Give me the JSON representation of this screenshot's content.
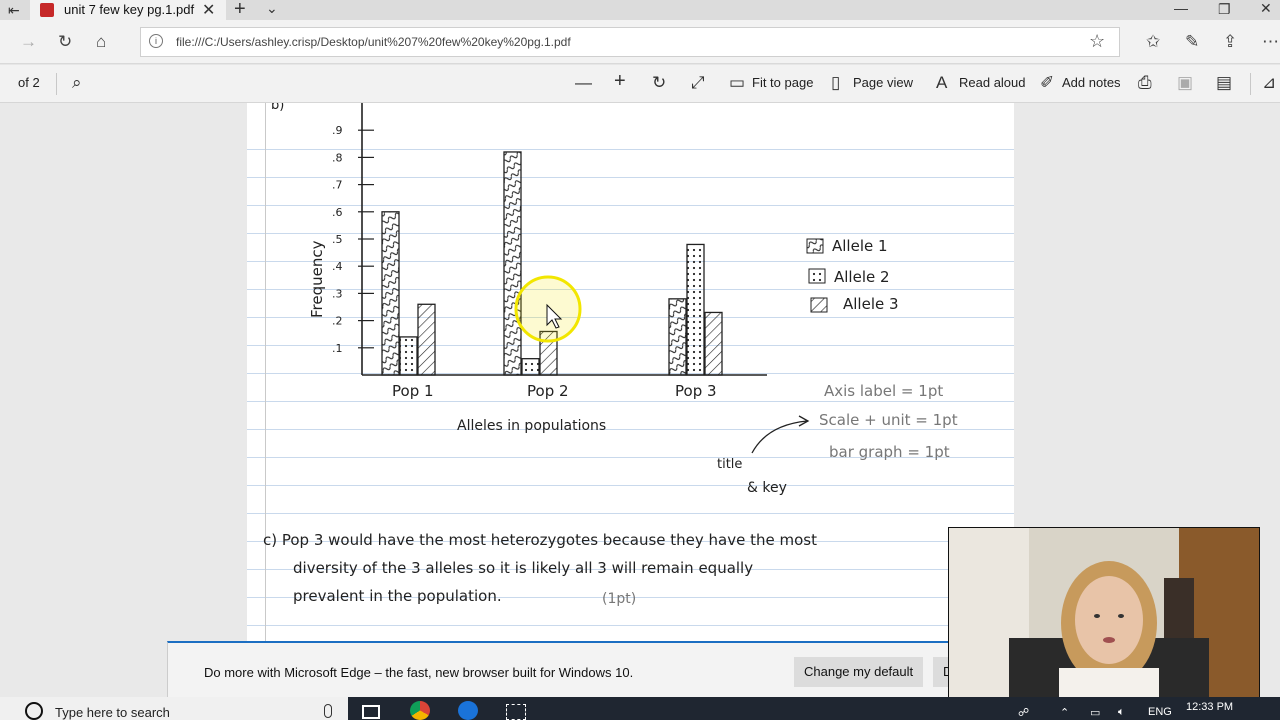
{
  "browser": {
    "tab_title": "unit 7 few key pg.1.pdf",
    "url": "file:///C:/Users/ashley.crisp/Desktop/unit%207%20few%20key%20pg.1.pdf"
  },
  "pdf_toolbar": {
    "page_count": "of 2",
    "fit_to_page": "Fit to page",
    "page_view": "Page view",
    "read_aloud": "Read aloud",
    "add_notes": "Add notes"
  },
  "document": {
    "question_label": "b)",
    "y_axis_label": "Frequency",
    "y_ticks": [
      ".1",
      ".2",
      ".3",
      ".4",
      ".5",
      ".6",
      ".7",
      ".8",
      ".9"
    ],
    "x_categories": [
      "Pop 1",
      "Pop 2",
      "Pop 3"
    ],
    "x_axis_label": "Alleles in populations",
    "legend": [
      "Allele 1",
      "Allele 2",
      "Allele 3"
    ],
    "rubric": [
      "Axis label = 1pt",
      "Scale + unit = 1pt",
      "bar graph = 1pt"
    ],
    "annotation_title": "title",
    "annotation_key": "& key",
    "answer_c": [
      "c) Pop 3 would have the most heterozygotes because they have the most",
      "diversity of the 3 alleles so it is likely all 3 will remain equally",
      "prevalent in the population."
    ],
    "answer_points": "(1pt)"
  },
  "chart_data": {
    "type": "bar",
    "categories": [
      "Pop 1",
      "Pop 2",
      "Pop 3"
    ],
    "series": [
      {
        "name": "Allele 1",
        "values": [
          0.6,
          0.82,
          0.28
        ]
      },
      {
        "name": "Allele 2",
        "values": [
          0.14,
          0.06,
          0.48
        ]
      },
      {
        "name": "Allele 3",
        "values": [
          0.26,
          0.16,
          0.23
        ]
      }
    ],
    "xlabel": "Alleles in populations",
    "ylabel": "Frequency",
    "ylim": [
      0,
      1.0
    ],
    "legend_position": "right"
  },
  "banner": {
    "message": "Do more with Microsoft Edge – the fast, new browser built for Windows 10.",
    "change_default": "Change my default",
    "dismiss": "D"
  },
  "taskbar": {
    "search_placeholder": "Type here to search",
    "language": "ENG",
    "time": "12:33 PM"
  },
  "colors": {
    "accent": "#1b6ec2",
    "cursor_highlight": "#f2e600"
  }
}
